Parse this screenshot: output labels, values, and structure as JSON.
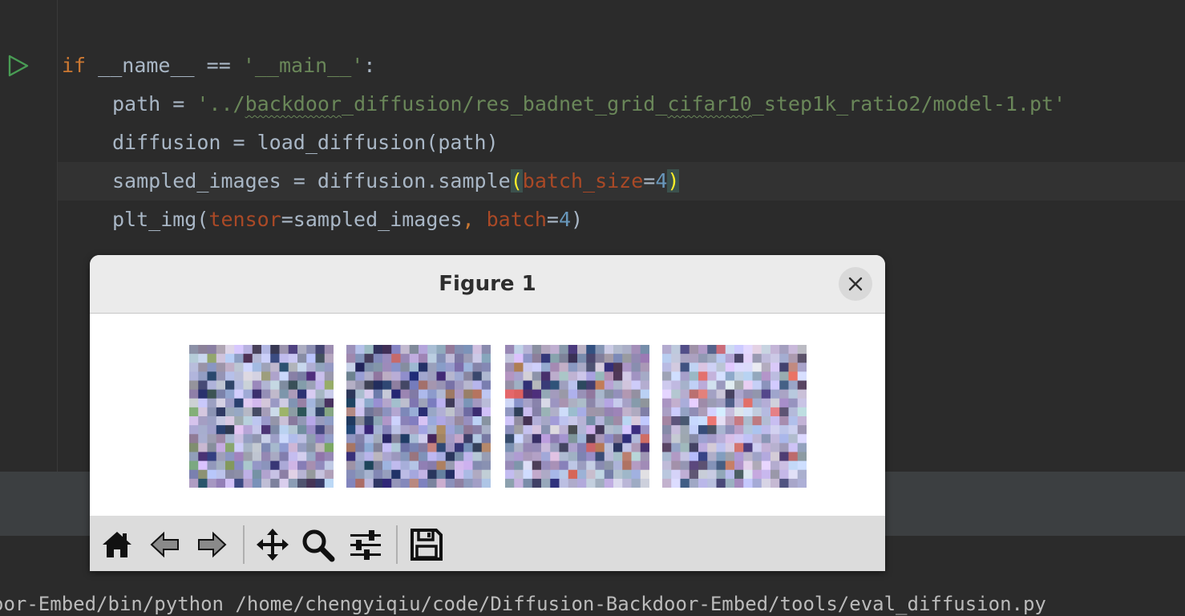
{
  "editor": {
    "code": {
      "line1": {
        "kw_if": "if",
        "name": "__name__",
        "eq": " == ",
        "str_main": "'__main__'",
        "colon": ":"
      },
      "line2": {
        "var": "path",
        "assign": " = ",
        "str_q1": "'../",
        "sq1": "backdoor",
        "mid": "_diffusion/res_badnet_grid_",
        "sq2": "cifar10",
        "rest": "_step1k_ratio2/model-1.pt'"
      },
      "line3": {
        "text": "diffusion = load_diffusion(path)"
      },
      "line4": {
        "prefix": "sampled_images = diffusion.sample",
        "open": "(",
        "param": "batch_size",
        "eq": "=",
        "num": "4",
        "close": ")"
      },
      "line5": {
        "prefix": "plt_img(",
        "param1": "tensor",
        "eq1": "=",
        "val1": "sampled_images",
        "comma": ", ",
        "param2": "batch",
        "eq2": "=",
        "num": "4",
        "close": ")"
      }
    }
  },
  "figure": {
    "title": "Figure 1",
    "close_icon": "close-icon",
    "toolbar": [
      "home-icon",
      "back-icon",
      "forward-icon",
      "pan-icon",
      "zoom-icon",
      "configure-subplots-icon",
      "save-icon"
    ],
    "images": [
      "sampled-image-1",
      "sampled-image-2",
      "sampled-image-3",
      "sampled-image-4"
    ]
  },
  "terminal": {
    "command": "oor-Embed/bin/python /home/chengyiqiu/code/Diffusion-Backdoor-Embed/tools/eval_diffusion.py"
  },
  "colors": {
    "keyword": "#cc7832",
    "string": "#6a8759",
    "param": "#aa4926",
    "number": "#6897bb",
    "text": "#a9b7c6",
    "run_icon": "#499c54"
  }
}
